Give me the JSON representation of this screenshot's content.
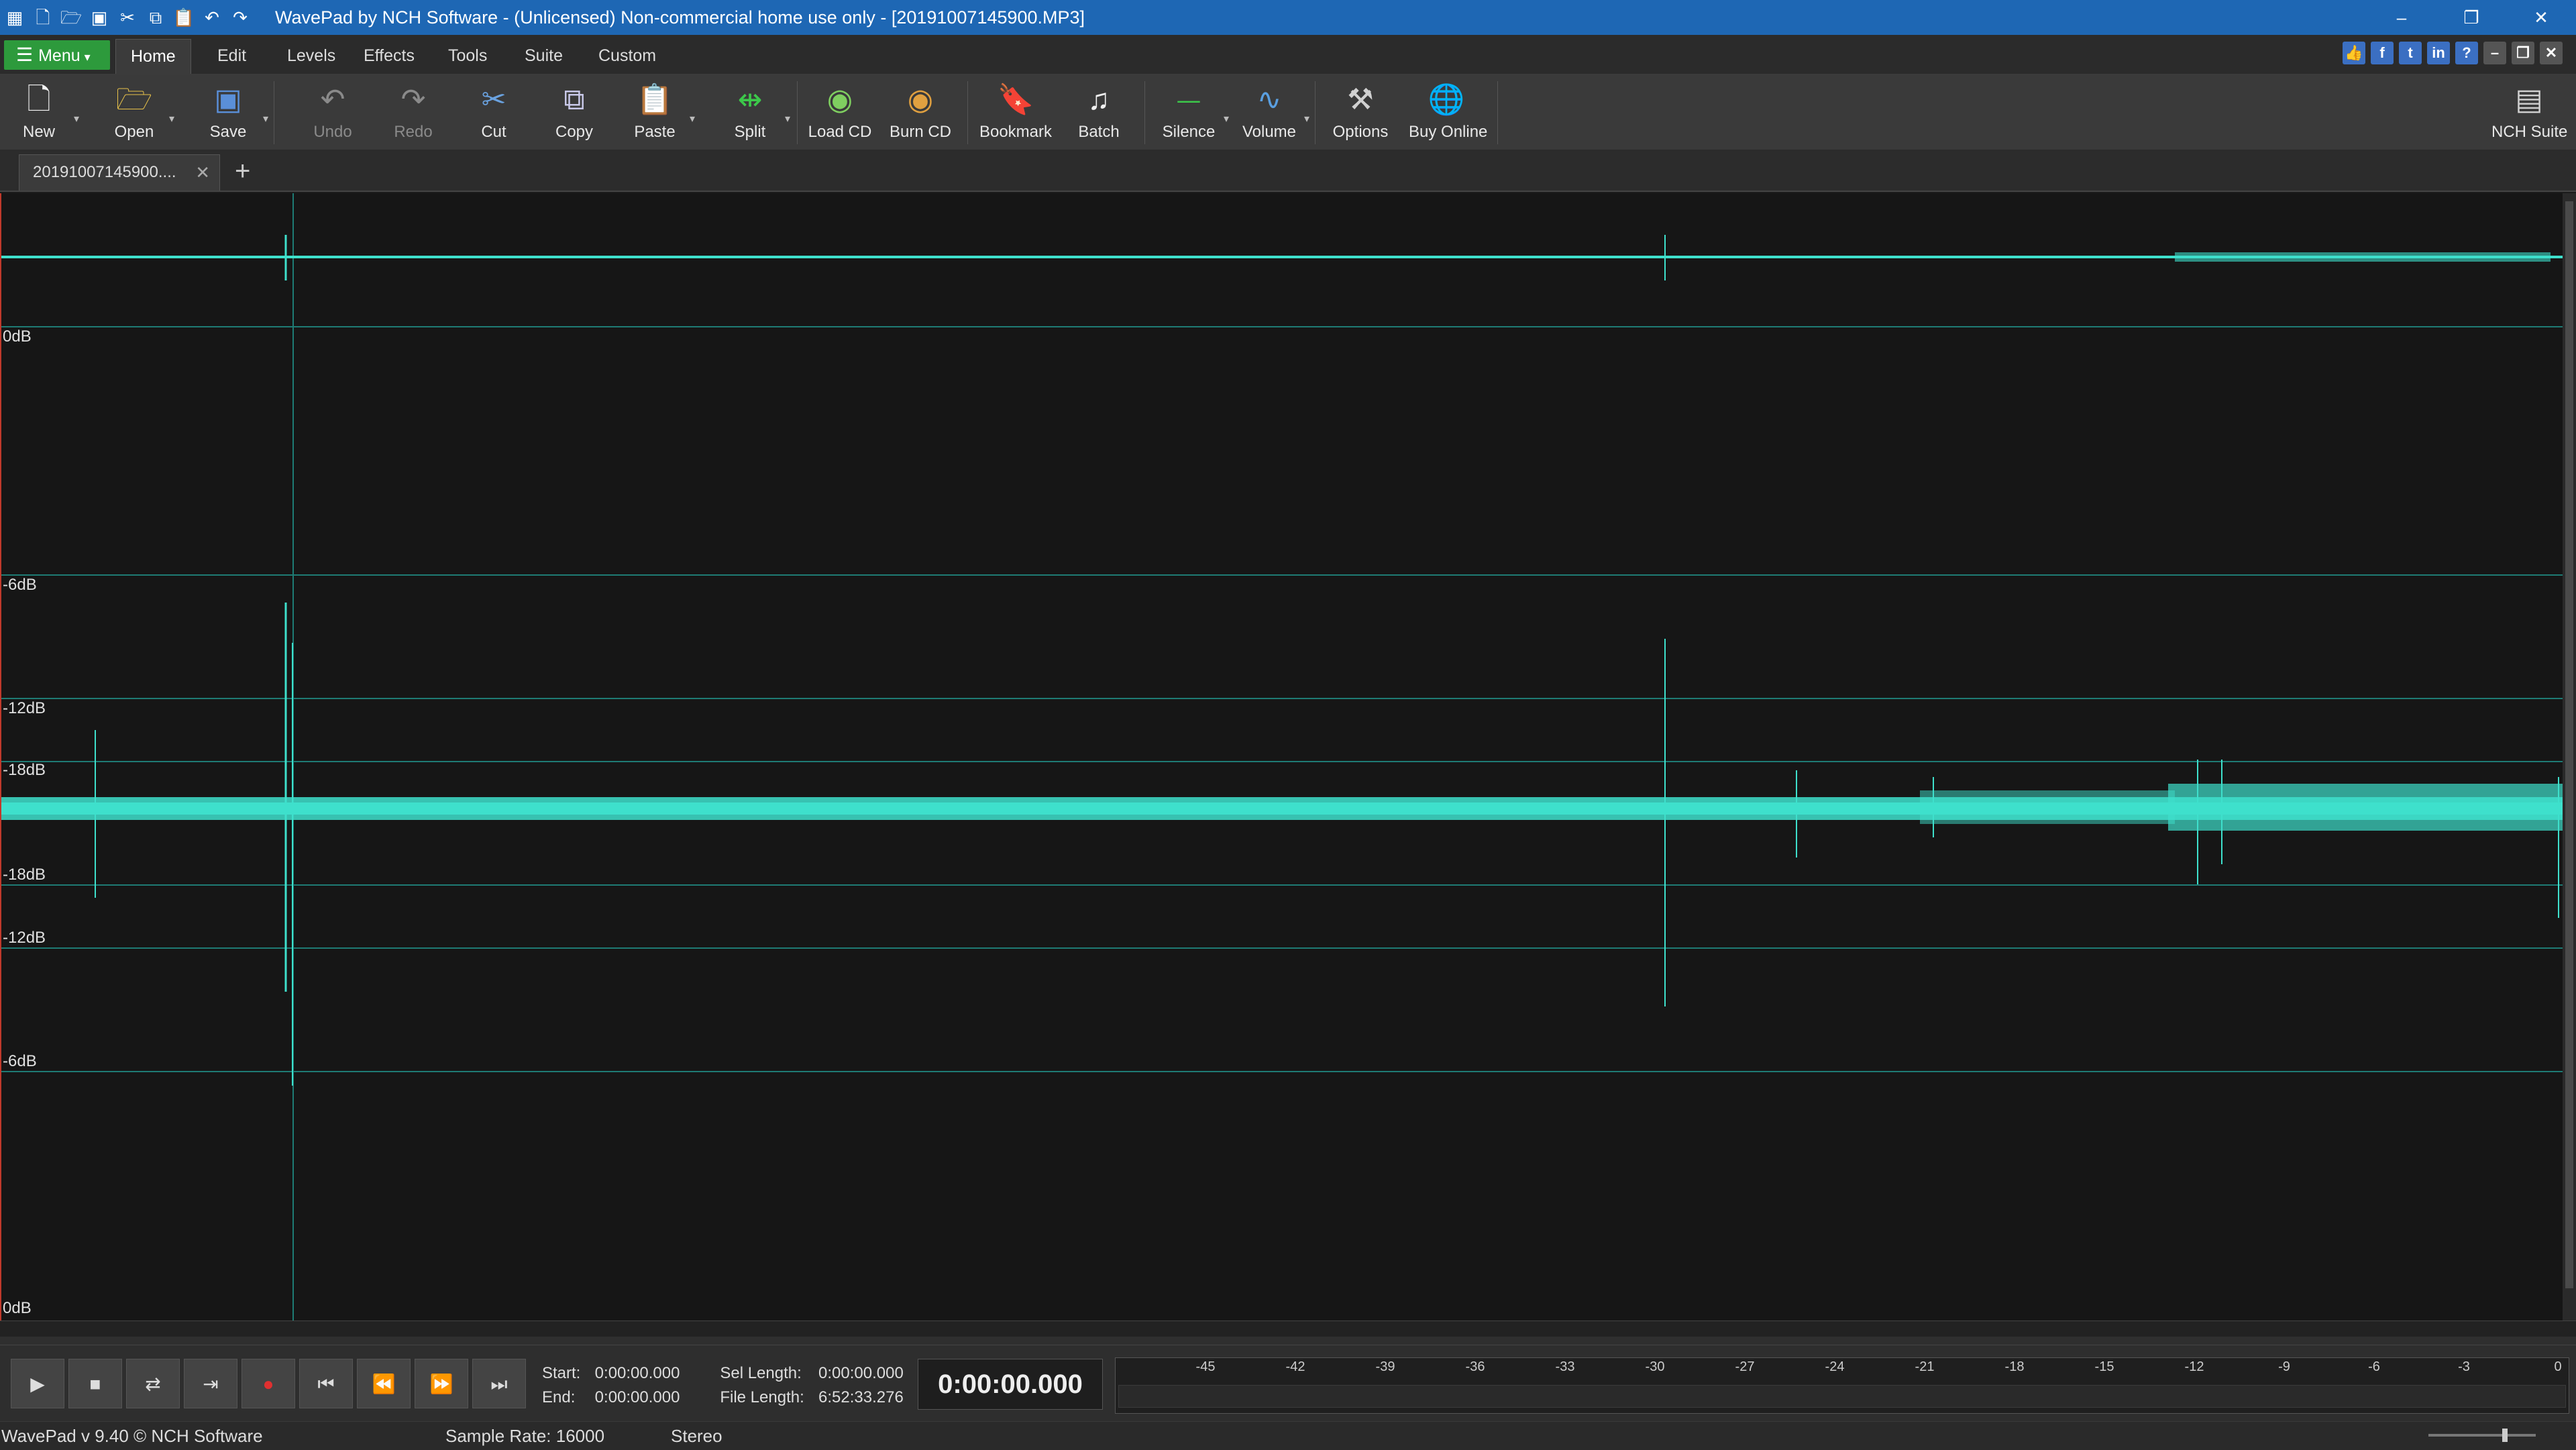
{
  "window": {
    "title": "WavePad by NCH Software - (Unlicensed) Non-commercial home use only - [20191007145900.MP3]",
    "qat_icons": [
      "wavepad-logo-icon",
      "new-file-icon",
      "open-folder-icon",
      "save-icon",
      "cut-icon",
      "copy-icon",
      "paste-icon",
      "undo-icon",
      "redo-icon"
    ],
    "controls": {
      "minimize": "–",
      "restore": "❐",
      "close": "✕"
    }
  },
  "menubar": {
    "menu_label": "Menu",
    "tabs": [
      "Home",
      "Edit",
      "Levels",
      "Effects",
      "Tools",
      "Suite",
      "Custom"
    ],
    "active_tab": "Home"
  },
  "toolbar": {
    "new": "New",
    "open": "Open",
    "save": "Save",
    "undo": "Undo",
    "redo": "Redo",
    "cut": "Cut",
    "copy": "Copy",
    "paste": "Paste",
    "split": "Split",
    "load_cd": "Load CD",
    "burn_cd": "Burn CD",
    "bookmark": "Bookmark",
    "batch": "Batch",
    "silence": "Silence",
    "volume": "Volume",
    "options": "Options",
    "buy_online": "Buy Online",
    "nch_suite": "NCH Suite"
  },
  "document_tab": {
    "label": "20191007145900....",
    "close": "✕",
    "add": "+"
  },
  "waveform": {
    "db_labels_top": [
      "0dB",
      "-6dB",
      "-12dB",
      "-18dB"
    ],
    "db_labels_bottom": [
      "-18dB",
      "-12dB",
      "-6dB",
      "0dB"
    ],
    "wave_color": "#3ee0cc",
    "grid_color": "#1e7b74"
  },
  "transport": {
    "buttons": [
      "▶",
      "■",
      "⇄",
      "⇥",
      "●",
      "⏮",
      "⏪",
      "⏩",
      "⏭"
    ],
    "start_label": "Start:",
    "start_value": "0:00:00.000",
    "end_label": "End:",
    "end_value": "0:00:00.000",
    "sel_length_label": "Sel Length:",
    "sel_length_value": "0:00:00.000",
    "file_length_label": "File Length:",
    "file_length_value": "6:52:33.276",
    "clock": "0:00:00.000",
    "meter_scale": [
      "-45",
      "-42",
      "-39",
      "-36",
      "-33",
      "-30",
      "-27",
      "-24",
      "-21",
      "-18",
      "-15",
      "-12",
      "-9",
      "-6",
      "-3",
      "0"
    ]
  },
  "statusbar": {
    "version": "WavePad v 9.40 © NCH Software",
    "sample_rate": "Sample Rate: 16000",
    "channels": "Stereo"
  }
}
